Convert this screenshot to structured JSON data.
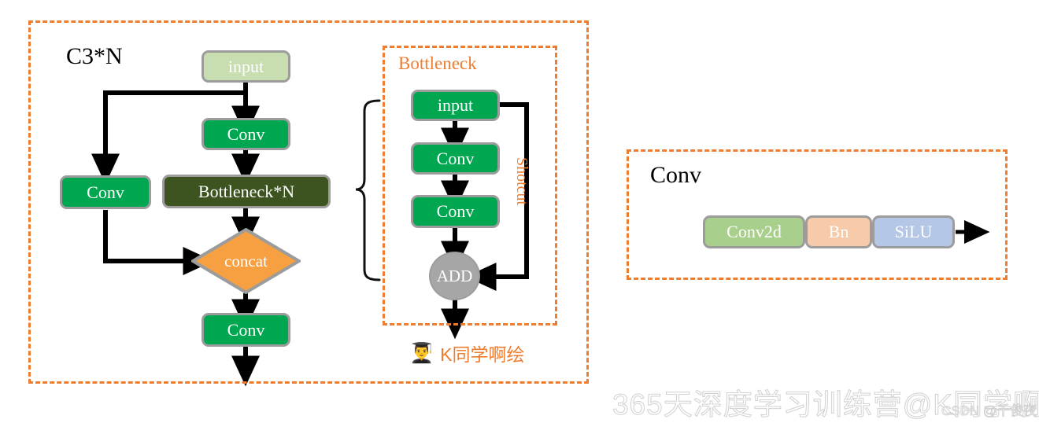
{
  "panels": {
    "c3n": {
      "title": "C3*N",
      "border_color": "#ED7D31"
    },
    "bottleneck": {
      "title": "Bottleneck",
      "border_color": "#ED7D31",
      "title_color": "#ED7D31"
    },
    "conv": {
      "title": "Conv",
      "border_color": "#ED7D31"
    }
  },
  "c3n_nodes": {
    "input": "input",
    "conv_top": "Conv",
    "conv_left": "Conv",
    "bottleneck_n": "Bottleneck*N",
    "concat": "concat",
    "conv_bottom": "Conv"
  },
  "bottleneck_nodes": {
    "input": "input",
    "conv1": "Conv",
    "conv2": "Conv",
    "add": "ADD",
    "shotcut": "Shotcut"
  },
  "conv_nodes": {
    "conv2d": "Conv2d",
    "bn": "Bn",
    "silu": "SiLU"
  },
  "signature": {
    "icon": "👨‍🎓",
    "text": "K同学啊绘"
  },
  "watermarks": {
    "main": "365天深度学习训练营@K同学啊",
    "csdn": "CSDN @千俊夜"
  },
  "colors": {
    "orange_border": "#ED7D31",
    "green_node": "#00A650",
    "light_green_node": "#C8DDB0",
    "dark_olive_node": "#3D5420",
    "concat_orange": "#F7A042",
    "add_gray": "#A6A6A6",
    "conv2d_green": "#A9CF8D",
    "bn_peach": "#F7CBAA",
    "silu_blue": "#B4C7E7",
    "node_stroke": "#9C9C9C",
    "arrow_black": "#000000"
  }
}
